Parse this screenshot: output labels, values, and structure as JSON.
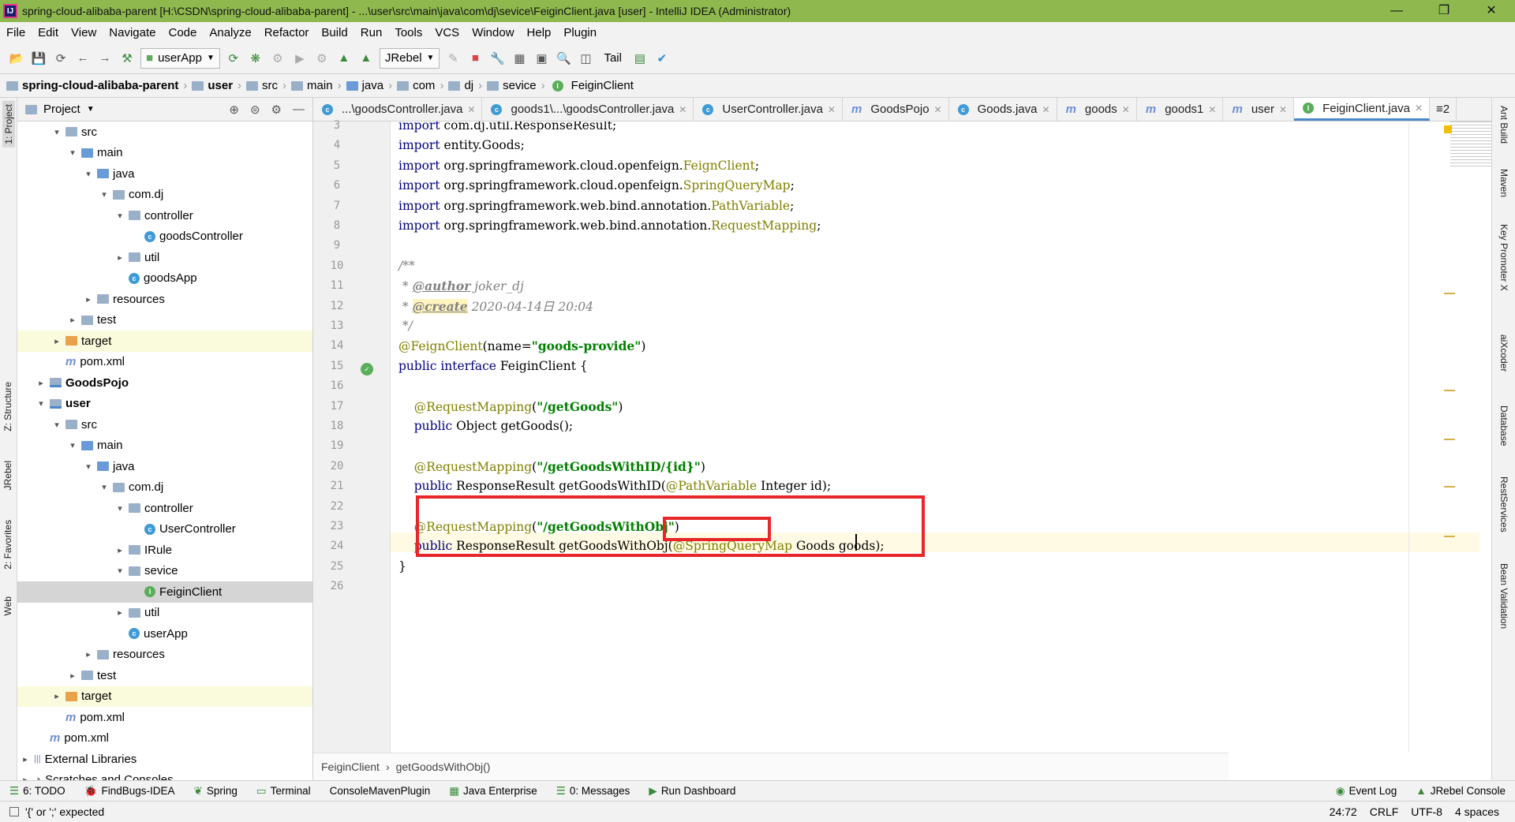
{
  "window": {
    "title": "spring-cloud-alibaba-parent [H:\\CSDN\\spring-cloud-alibaba-parent] - ...\\user\\src\\main\\java\\com\\dj\\sevice\\FeiginClient.java [user] - IntelliJ IDEA (Administrator)",
    "app_icon": "IJ"
  },
  "menu": [
    "File",
    "Edit",
    "View",
    "Navigate",
    "Code",
    "Analyze",
    "Refactor",
    "Build",
    "Run",
    "Tools",
    "VCS",
    "Window",
    "Help",
    "Plugin"
  ],
  "toolbar": {
    "run_config": "userApp",
    "jrebel": "JRebel",
    "tail": "Tail"
  },
  "breadcrumb": [
    "spring-cloud-alibaba-parent",
    "user",
    "src",
    "main",
    "java",
    "com",
    "dj",
    "sevice",
    "FeiginClient"
  ],
  "project_panel": {
    "title": "Project",
    "tree": [
      {
        "indent": 3,
        "arrow": "▾",
        "icon": "folder",
        "label": "src"
      },
      {
        "indent": 4,
        "arrow": "▾",
        "icon": "folder-blue",
        "label": "main"
      },
      {
        "indent": 5,
        "arrow": "▾",
        "icon": "folder-blue",
        "label": "java"
      },
      {
        "indent": 6,
        "arrow": "▾",
        "icon": "folder",
        "label": "com.dj"
      },
      {
        "indent": 7,
        "arrow": "▾",
        "icon": "folder",
        "label": "controller"
      },
      {
        "indent": 8,
        "arrow": "",
        "icon": "class",
        "label": "goodsController"
      },
      {
        "indent": 7,
        "arrow": "▸",
        "icon": "folder",
        "label": "util"
      },
      {
        "indent": 7,
        "arrow": "",
        "icon": "class",
        "label": "goodsApp"
      },
      {
        "indent": 5,
        "arrow": "▸",
        "icon": "folder",
        "label": "resources"
      },
      {
        "indent": 4,
        "arrow": "▸",
        "icon": "folder",
        "label": "test"
      },
      {
        "indent": 3,
        "arrow": "▸",
        "icon": "folder-orange",
        "label": "target",
        "hl": true
      },
      {
        "indent": 3,
        "arrow": "",
        "icon": "maven",
        "label": "pom.xml"
      },
      {
        "indent": 2,
        "arrow": "▸",
        "icon": "module",
        "label": "GoodsPojo",
        "bold": true
      },
      {
        "indent": 2,
        "arrow": "▾",
        "icon": "module",
        "label": "user",
        "bold": true
      },
      {
        "indent": 3,
        "arrow": "▾",
        "icon": "folder",
        "label": "src"
      },
      {
        "indent": 4,
        "arrow": "▾",
        "icon": "folder-blue",
        "label": "main"
      },
      {
        "indent": 5,
        "arrow": "▾",
        "icon": "folder-blue",
        "label": "java"
      },
      {
        "indent": 6,
        "arrow": "▾",
        "icon": "folder",
        "label": "com.dj"
      },
      {
        "indent": 7,
        "arrow": "▾",
        "icon": "folder",
        "label": "controller"
      },
      {
        "indent": 8,
        "arrow": "",
        "icon": "class",
        "label": "UserController"
      },
      {
        "indent": 7,
        "arrow": "▸",
        "icon": "folder",
        "label": "IRule"
      },
      {
        "indent": 7,
        "arrow": "▾",
        "icon": "folder",
        "label": "sevice"
      },
      {
        "indent": 8,
        "arrow": "",
        "icon": "interface",
        "label": "FeiginClient",
        "sel": true
      },
      {
        "indent": 7,
        "arrow": "▸",
        "icon": "folder",
        "label": "util"
      },
      {
        "indent": 7,
        "arrow": "",
        "icon": "class",
        "label": "userApp"
      },
      {
        "indent": 5,
        "arrow": "▸",
        "icon": "folder",
        "label": "resources"
      },
      {
        "indent": 4,
        "arrow": "▸",
        "icon": "folder",
        "label": "test"
      },
      {
        "indent": 3,
        "arrow": "▸",
        "icon": "folder-orange",
        "label": "target",
        "hl": true
      },
      {
        "indent": 3,
        "arrow": "",
        "icon": "maven",
        "label": "pom.xml"
      },
      {
        "indent": 2,
        "arrow": "",
        "icon": "maven",
        "label": "pom.xml"
      },
      {
        "indent": 1,
        "arrow": "▸",
        "icon": "libs",
        "label": "External Libraries"
      },
      {
        "indent": 1,
        "arrow": "▸",
        "icon": "scratch",
        "label": "Scratches and Consoles"
      }
    ]
  },
  "tabs": [
    {
      "label": "...\\goodsController.java",
      "icon": "class"
    },
    {
      "label": "goods1\\...\\goodsController.java",
      "icon": "class"
    },
    {
      "label": "UserController.java",
      "icon": "class"
    },
    {
      "label": "GoodsPojo",
      "icon": "maven"
    },
    {
      "label": "Goods.java",
      "icon": "class"
    },
    {
      "label": "goods",
      "icon": "maven"
    },
    {
      "label": "goods1",
      "icon": "maven"
    },
    {
      "label": "user",
      "icon": "maven"
    },
    {
      "label": "FeiginClient.java",
      "icon": "interface",
      "active": true
    }
  ],
  "tabs_overflow": "≡2",
  "code_lines": [
    {
      "n": "3",
      "html": "<span class='kw'>import</span> com.dj.util.ResponseResult;"
    },
    {
      "n": "4",
      "html": "<span class='kw'>import</span> entity.Goods;"
    },
    {
      "n": "5",
      "html": "<span class='kw'>import</span> org.springframework.cloud.openfeign.<span class='ann'>FeignClient</span>;"
    },
    {
      "n": "6",
      "html": "<span class='kw'>import</span> org.springframework.cloud.openfeign.<span class='ann'>SpringQueryMap</span>;"
    },
    {
      "n": "7",
      "html": "<span class='kw'>import</span> org.springframework.web.bind.annotation.<span class='ann'>PathVariable</span>;"
    },
    {
      "n": "8",
      "html": "<span class='kw'>import</span> org.springframework.web.bind.annotation.<span class='ann'>RequestMapping</span>;"
    },
    {
      "n": "9",
      "html": ""
    },
    {
      "n": "10",
      "html": "<span class='cmt'>/**</span>"
    },
    {
      "n": "11",
      "html": "<span class='cmt'> * </span><span class='tag'>@author</span><span class='cmt'> joker_dj</span>"
    },
    {
      "n": "12",
      "html": "<span class='cmt'> * </span><span class='tag' style='background:#fff4c0'>@create</span><span class='cmt'> 2020-04-14日 20:04</span>"
    },
    {
      "n": "13",
      "html": "<span class='cmt'> */</span>"
    },
    {
      "n": "14",
      "html": "<span class='ann'>@FeignClient</span>(name=<span class='str'>\"goods-provide\"</span>)"
    },
    {
      "n": "15",
      "html": "<span class='kw'>public interface</span> FeiginClient {"
    },
    {
      "n": "16",
      "html": ""
    },
    {
      "n": "17",
      "html": "    <span class='ann'>@RequestMapping</span>(<span class='str'>\"/getGoods\"</span>)"
    },
    {
      "n": "18",
      "html": "    <span class='kw'>public</span> Object getGoods();"
    },
    {
      "n": "19",
      "html": ""
    },
    {
      "n": "20",
      "html": "    <span class='ann'>@RequestMapping</span>(<span class='str'>\"/getGoodsWithID/{id}\"</span>)"
    },
    {
      "n": "21",
      "html": "    <span class='kw'>public</span> ResponseResult getGoodsWithID(<span class='ann'>@PathVariable</span> Integer id);"
    },
    {
      "n": "22",
      "html": ""
    },
    {
      "n": "23",
      "html": "    <span class='ann'>@RequestMapping</span>(<span class='str'>\"/getGoodsWithObj\"</span>)"
    },
    {
      "n": "24",
      "html": "    <span class='kw'>public</span> ResponseResult getGoodsWithObj(<span class='ann'>@SpringQueryMap</span> Goods goods);"
    },
    {
      "n": "25",
      "html": "}"
    },
    {
      "n": "26",
      "html": ""
    }
  ],
  "editor_breadcrumb": [
    "FeiginClient",
    "getGoodsWithObj()"
  ],
  "left_tools": [
    "1: Project",
    "Z: Structure",
    "JRebel",
    "2: Favorites",
    "Web"
  ],
  "right_tools": [
    "Ant Build",
    "Maven",
    "Key Promoter X",
    "aiXcoder",
    "Database",
    "RestServices",
    "Bean Validation"
  ],
  "bottom_tools": [
    {
      "label": "6: TODO",
      "icon": "todo-icon"
    },
    {
      "label": "FindBugs-IDEA",
      "icon": "bug-icon"
    },
    {
      "label": "Spring",
      "icon": "spring-icon"
    },
    {
      "label": "Terminal",
      "icon": "terminal-icon"
    },
    {
      "label": "ConsoleMavenPlugin",
      "icon": ""
    },
    {
      "label": "Java Enterprise",
      "icon": "enterprise-icon"
    },
    {
      "label": "0: Messages",
      "icon": "messages-icon"
    },
    {
      "label": "Run Dashboard",
      "icon": "run-icon"
    }
  ],
  "bottom_right_tools": [
    {
      "label": "Event Log",
      "icon": "eventlog-icon"
    },
    {
      "label": "JRebel Console",
      "icon": "jrebel-icon"
    }
  ],
  "status": {
    "message": "'{' or ';' expected",
    "position": "24:72",
    "line_sep": "CRLF",
    "encoding": "UTF-8",
    "indent": "4 spaces"
  },
  "colors": {
    "titlebar": "#8fb94f",
    "highlight_box": "#e8262a",
    "keyword": "#000080",
    "annotation": "#808000",
    "string": "#008000"
  }
}
